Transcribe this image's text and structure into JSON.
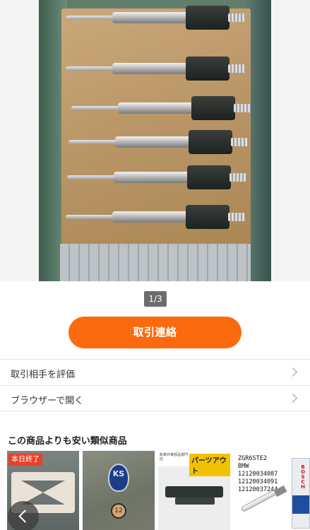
{
  "gallery": {
    "pager": "1/3",
    "image_description_icon": "product-photo-icon"
  },
  "actions": {
    "contact_button": "取引連絡"
  },
  "menu": {
    "rate_partner": "取引相手を評価",
    "open_browser": "ブラウザーで開く"
  },
  "similar": {
    "title": "この商品よりも安い類似商品",
    "items": [
      {
        "badge": "本日終了"
      },
      {
        "emblem": "KS",
        "tag": "12"
      },
      {
        "shop_sub": "新車外車部品専門店",
        "shop_name": "パーツアウト"
      },
      {
        "spec": "ZGR6STE2\nBMW\n12120034087\n12120034091\n12120037244",
        "brand": "BOSCH"
      }
    ]
  },
  "colors": {
    "accent": "#fb6a0e",
    "badge": "#e8412b"
  }
}
